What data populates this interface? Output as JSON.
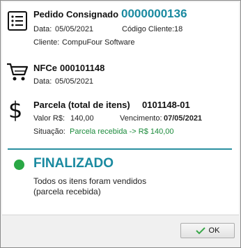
{
  "pedido": {
    "title": "Pedido Consignado",
    "number": "0000000136",
    "data_label": "Data:",
    "data_value": "05/05/2021",
    "cliente_codigo_label": "Código Cliente:",
    "cliente_codigo_value": "18",
    "cliente_label": "Cliente:",
    "cliente_value": "CompuFour Software"
  },
  "nfce": {
    "title": "NFCe",
    "number": "000101148",
    "data_label": "Data:",
    "data_value": "05/05/2021"
  },
  "parcela": {
    "title": "Parcela (total de itens)",
    "number": "0101148-01",
    "valor_label": "Valor R$:",
    "valor_value": "140,00",
    "vencimento_label": "Vencimento:",
    "vencimento_value": "07/05/2021",
    "situacao_label": "Situação:",
    "situacao_value": "Parcela recebida -> R$ 140,00"
  },
  "status": {
    "title": "FINALIZADO",
    "line1": "Todos os itens foram vendidos",
    "line2": "(parcela recebida)",
    "color": "#2aa845"
  },
  "footer": {
    "ok_label": "OK"
  },
  "icons": {
    "pedido": "list-icon",
    "nfce": "cart-icon",
    "parcela": "dollar-icon",
    "ok": "checkmark-icon"
  }
}
